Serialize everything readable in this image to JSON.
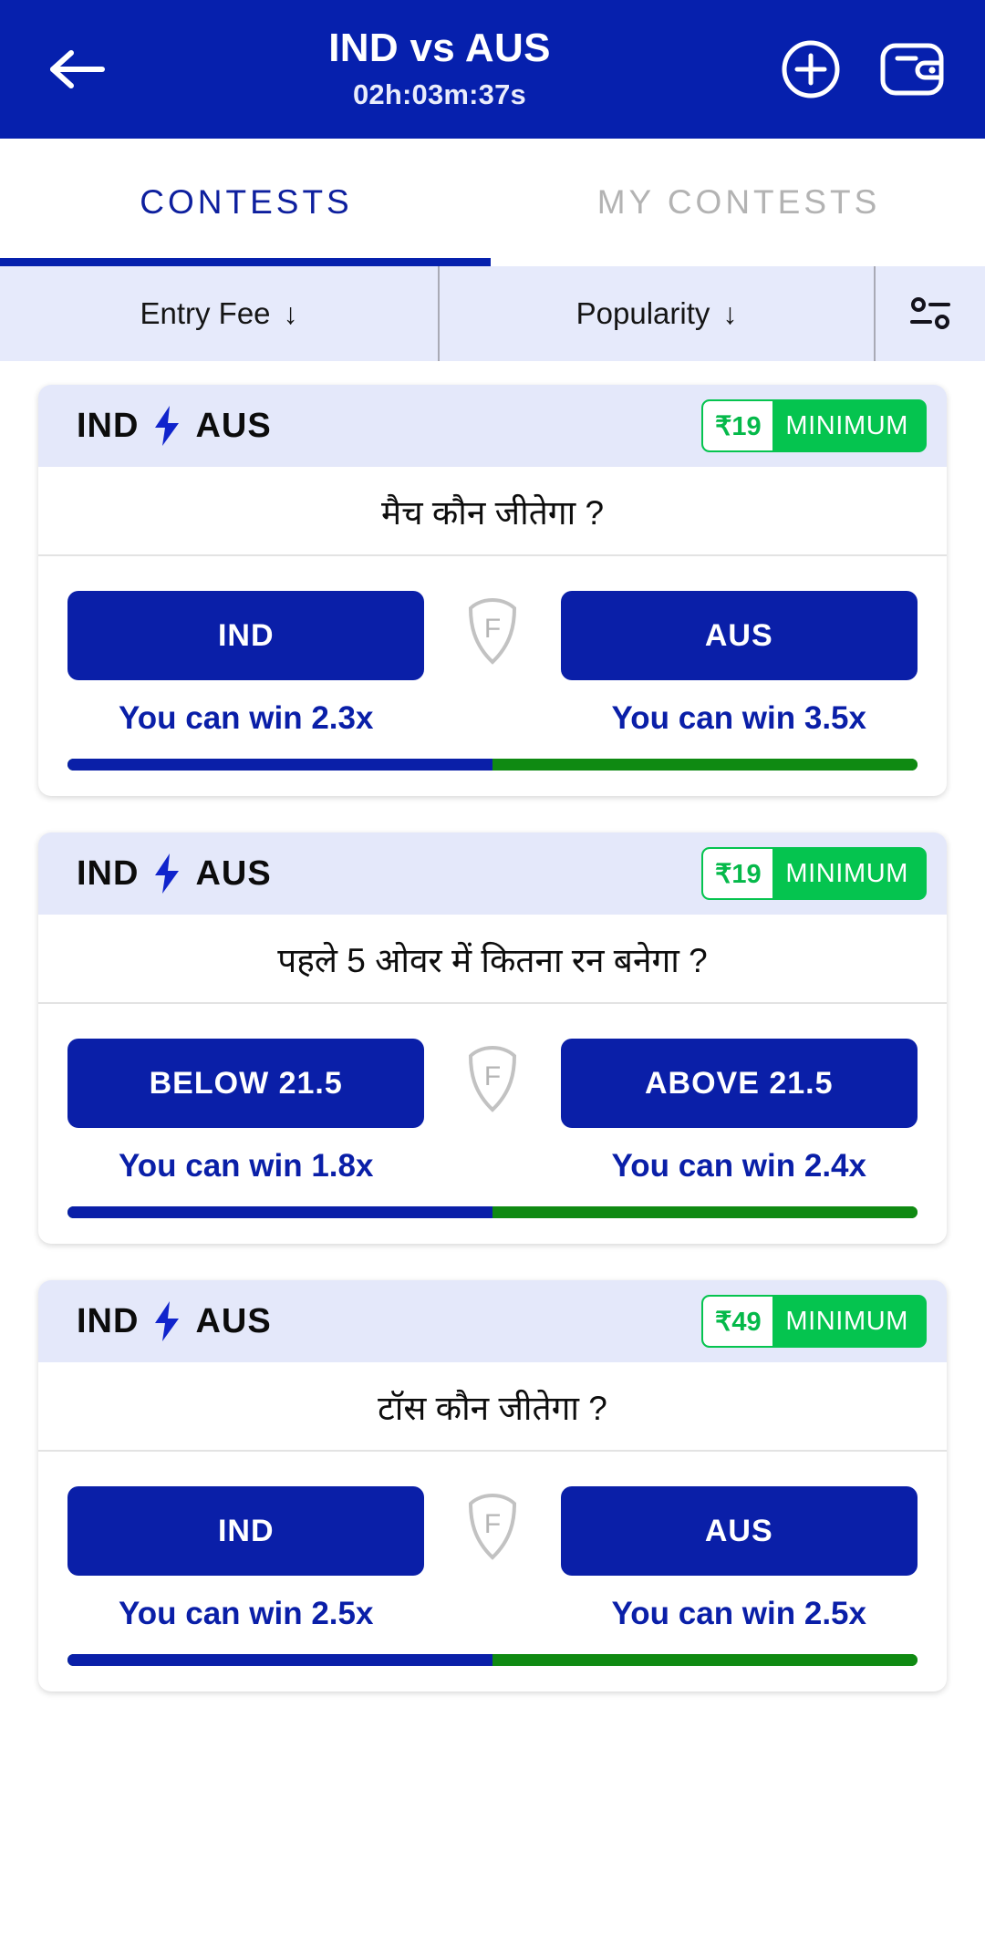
{
  "header": {
    "back_icon": "arrow-left-icon",
    "title": "IND vs AUS",
    "timer": "02h:03m:37s",
    "add_icon": "plus-circle-icon",
    "wallet_icon": "wallet-icon"
  },
  "tabs": [
    {
      "label": "CONTESTS",
      "active": true
    },
    {
      "label": "MY CONTESTS",
      "active": false
    }
  ],
  "filters": {
    "entry_fee": "Entry Fee",
    "entry_fee_arrow": "↓",
    "popularity": "Popularity",
    "popularity_arrow": "↓",
    "settings_icon": "sliders-filter-icon"
  },
  "colors": {
    "brand_blue": "#0620AD",
    "button_blue": "#0A1FA8",
    "badge_green": "#05C44F",
    "progress_green": "#0F8A12",
    "card_head_bg": "#E4E8FA",
    "filter_bg": "#E6EAFB",
    "inactive_tab": "#B3B3B3"
  },
  "contests": [
    {
      "team_left": "IND",
      "team_right": "AUS",
      "vs_icon": "lightning-bolt-icon",
      "badge_amount": "₹19",
      "badge_label": "MINIMUM",
      "question": "मैच कौन जीतेगा ?",
      "shield_icon": "shield-f-icon",
      "option_left": {
        "label": "IND",
        "win_text": "You can win 2.3x"
      },
      "option_right": {
        "label": "AUS",
        "win_text": "You can win 3.5x"
      },
      "progress_left_pct": 50
    },
    {
      "team_left": "IND",
      "team_right": "AUS",
      "vs_icon": "lightning-bolt-icon",
      "badge_amount": "₹19",
      "badge_label": "MINIMUM",
      "question": "पहले 5 ओवर में कितना रन बनेगा ?",
      "shield_icon": "shield-f-icon",
      "option_left": {
        "label": "BELOW 21.5",
        "win_text": "You can win 1.8x"
      },
      "option_right": {
        "label": "ABOVE 21.5",
        "win_text": "You can win 2.4x"
      },
      "progress_left_pct": 50
    },
    {
      "team_left": "IND",
      "team_right": "AUS",
      "vs_icon": "lightning-bolt-icon",
      "badge_amount": "₹49",
      "badge_label": "MINIMUM",
      "question": "टॉस कौन जीतेगा ?",
      "shield_icon": "shield-f-icon",
      "option_left": {
        "label": "IND",
        "win_text": "You can win 2.5x"
      },
      "option_right": {
        "label": "AUS",
        "win_text": "You can win 2.5x"
      },
      "progress_left_pct": 50
    }
  ]
}
